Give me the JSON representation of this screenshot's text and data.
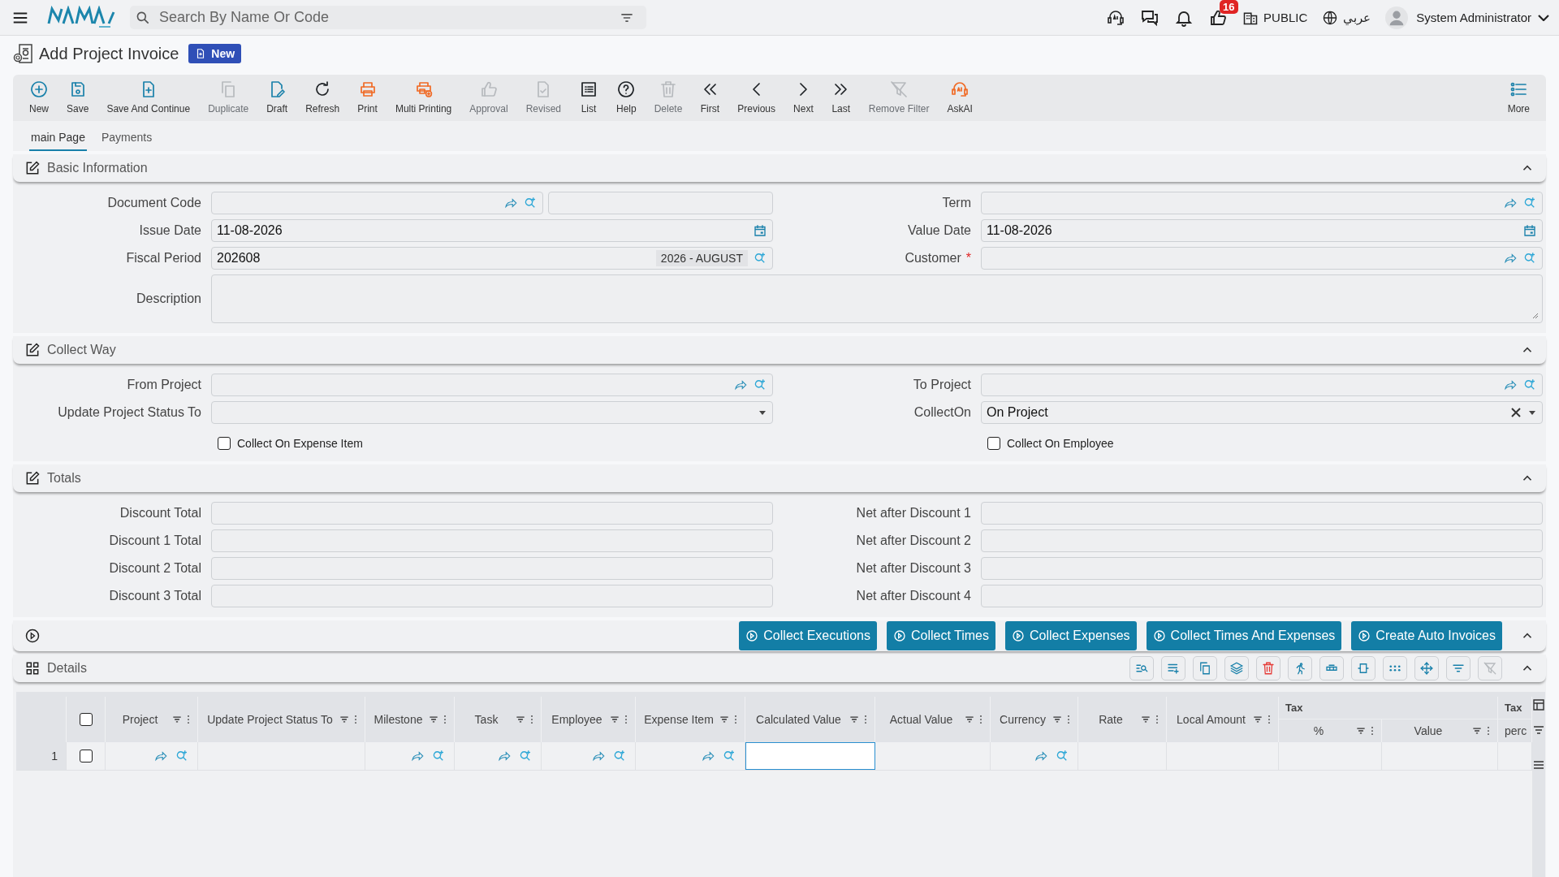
{
  "topbar": {
    "search": {
      "placeholder": "Search By Name Or Code"
    },
    "notification_count": "16",
    "company": "PUBLIC",
    "language": "عربي",
    "user": "System Administrator"
  },
  "title": "Add Project Invoice",
  "status_badge": "New",
  "toolbar": [
    {
      "label": "New",
      "kind": "plus",
      "disabled": false
    },
    {
      "label": "Save",
      "kind": "save",
      "disabled": false
    },
    {
      "label": "Save And Continue",
      "kind": "filePlus",
      "disabled": false
    },
    {
      "label": "Duplicate",
      "kind": "copy",
      "disabled": true
    },
    {
      "label": "Draft",
      "kind": "draft",
      "disabled": false
    },
    {
      "label": "Refresh",
      "kind": "refresh",
      "disabled": false
    },
    {
      "label": "Print",
      "kind": "print",
      "disabled": false
    },
    {
      "label": "Multi Printing",
      "kind": "multiprint",
      "disabled": false
    },
    {
      "label": "Approval",
      "kind": "thumb",
      "disabled": true
    },
    {
      "label": "Revised",
      "kind": "fileCheck",
      "disabled": true
    },
    {
      "label": "List",
      "kind": "list",
      "disabled": false
    },
    {
      "label": "Help",
      "kind": "help",
      "disabled": false
    },
    {
      "label": "Delete",
      "kind": "trash",
      "disabled": true
    },
    {
      "label": "First",
      "kind": "first",
      "disabled": false
    },
    {
      "label": "Previous",
      "kind": "prev",
      "disabled": false
    },
    {
      "label": "Next",
      "kind": "next",
      "disabled": false
    },
    {
      "label": "Last",
      "kind": "last",
      "disabled": false
    },
    {
      "label": "Remove Filter",
      "kind": "filterOff",
      "disabled": true
    },
    {
      "label": "AskAI",
      "kind": "ai",
      "disabled": false
    },
    {
      "label": "More",
      "kind": "more",
      "disabled": false
    }
  ],
  "tabs": [
    {
      "label": "main Page",
      "selected": true
    },
    {
      "label": "Payments",
      "selected": false
    }
  ],
  "sections": [
    {
      "title": "Basic Information",
      "expanded": true,
      "fields": [
        {
          "label": "Document Code",
          "kind": "code"
        },
        {
          "label": "Term",
          "kind": "lookup"
        },
        {
          "label": "Issue Date",
          "kind": "date",
          "value": "11-08-2026"
        },
        {
          "label": "Value Date",
          "kind": "date",
          "value": "11-08-2026"
        },
        {
          "label": "Fiscal Period",
          "kind": "period",
          "value": "202608",
          "tag": "2026 - AUGUST"
        },
        {
          "label": "Customer",
          "kind": "lookup",
          "required_mark": "*"
        },
        {
          "label": "Description",
          "kind": "textarea"
        }
      ]
    },
    {
      "title": "Collect Way",
      "expanded": true,
      "fields": [
        {
          "label": "From Project",
          "kind": "lookup"
        },
        {
          "label": "To Project",
          "kind": "lookup"
        },
        {
          "label": "Update Project Status To",
          "kind": "select"
        },
        {
          "label": "CollectOn",
          "kind": "select",
          "value": "On Project"
        },
        {
          "label": "Collect On Expense Item",
          "kind": "checkbox",
          "checked": false
        },
        {
          "label": "Collect On Employee",
          "kind": "checkbox",
          "checked": false
        }
      ]
    },
    {
      "title": "Totals",
      "expanded": true,
      "fields": [
        {
          "label": "Discount Total",
          "kind": "text"
        },
        {
          "label": "Net after Discount 1",
          "kind": "text"
        },
        {
          "label": "Discount 1 Total",
          "kind": "text"
        },
        {
          "label": "Net after Discount 2",
          "kind": "text"
        },
        {
          "label": "Discount 2 Total",
          "kind": "text"
        },
        {
          "label": "Net after Discount 3",
          "kind": "text"
        },
        {
          "label": "Discount 3 Total",
          "kind": "text"
        },
        {
          "label": "Net after Discount 4",
          "kind": "text"
        }
      ]
    }
  ],
  "actions": {
    "expanded": true,
    "buttons": [
      "Collect Executions",
      "Collect Times",
      "Collect Expenses",
      "Collect Times And Expenses",
      "Create Auto Invoices"
    ]
  },
  "details": {
    "title": "Details",
    "expanded": true,
    "header_checked": false,
    "columns": [
      {
        "label": "Project",
        "lookup": true,
        "focused": false
      },
      {
        "label": "Update Project Status To",
        "lookup": false,
        "focused": false
      },
      {
        "label": "Milestone",
        "lookup": true,
        "focused": false
      },
      {
        "label": "Task",
        "lookup": true,
        "focused": false
      },
      {
        "label": "Employee",
        "lookup": true,
        "focused": false
      },
      {
        "label": "Expense Item",
        "lookup": true,
        "focused": false
      },
      {
        "label": "Calculated Value",
        "lookup": false,
        "focused": true
      },
      {
        "label": "Actual Value",
        "lookup": false,
        "focused": false
      },
      {
        "label": "Currency",
        "lookup": true,
        "focused": false
      },
      {
        "label": "Rate",
        "lookup": false,
        "focused": false
      },
      {
        "label": "Local Amount",
        "lookup": false,
        "focused": false
      }
    ],
    "column_groups": [
      {
        "label": "Tax",
        "columns": [
          "%",
          "Value"
        ]
      },
      {
        "label": "Tax",
        "columns": [
          "perc"
        ]
      }
    ],
    "rows": [
      {
        "number": "1",
        "checked": false
      }
    ]
  }
}
